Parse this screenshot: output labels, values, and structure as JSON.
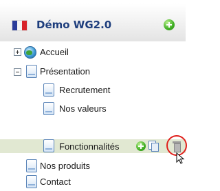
{
  "header": {
    "title": "Démo WG2.0",
    "flag_icon": "france-flag-icon",
    "add_icon": "add-circle-icon"
  },
  "tree": {
    "accueil": "Accueil",
    "presentation": "Présentation",
    "recrutement": "Recrutement",
    "nos_valeurs": "Nos valeurs",
    "fonctionnalites": "Fonctionnalités",
    "nos_produits": "Nos produits",
    "contact": "Contact"
  },
  "selected_item": "Fonctionnalités",
  "colors": {
    "title": "#1e3e7d",
    "selection": "#e1e8d2",
    "highlight_ring": "#e0201c"
  }
}
